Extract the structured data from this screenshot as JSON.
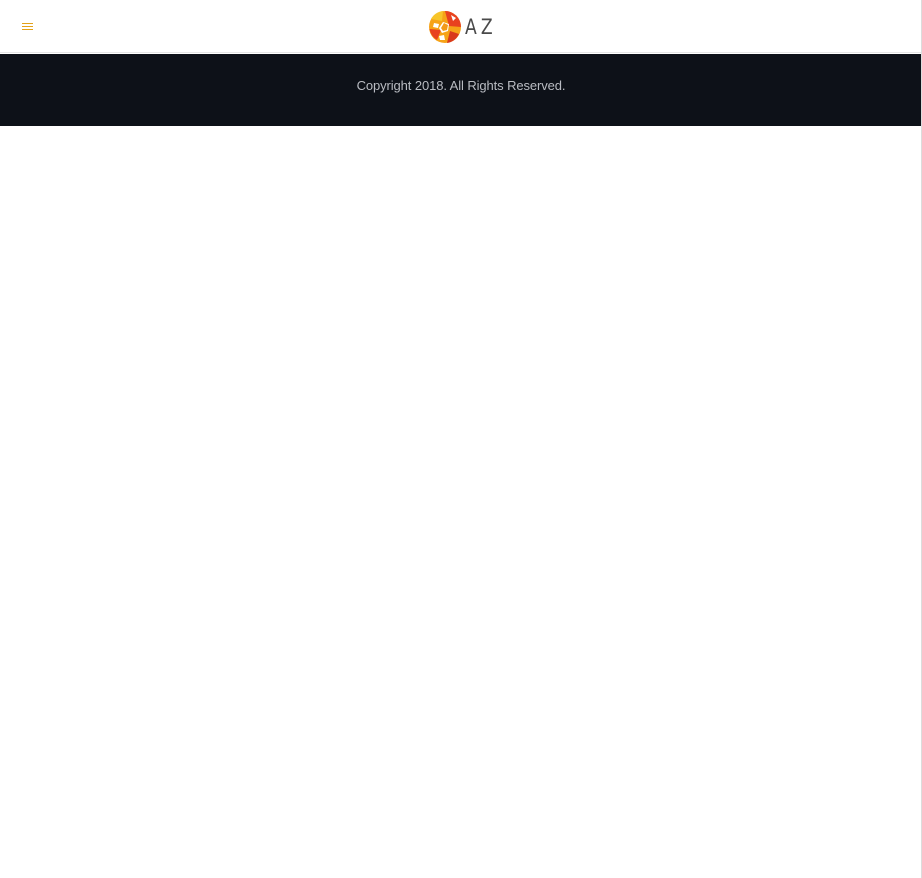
{
  "header": {
    "menu_icon": "hamburger-menu-icon",
    "logo_text": "AZ",
    "logo_icon": "az-logo-mark",
    "accent_color": "#e3a21a"
  },
  "footer": {
    "copyright": "Copyright 2018. All Rights Reserved.",
    "background_color": "#0d1118"
  }
}
